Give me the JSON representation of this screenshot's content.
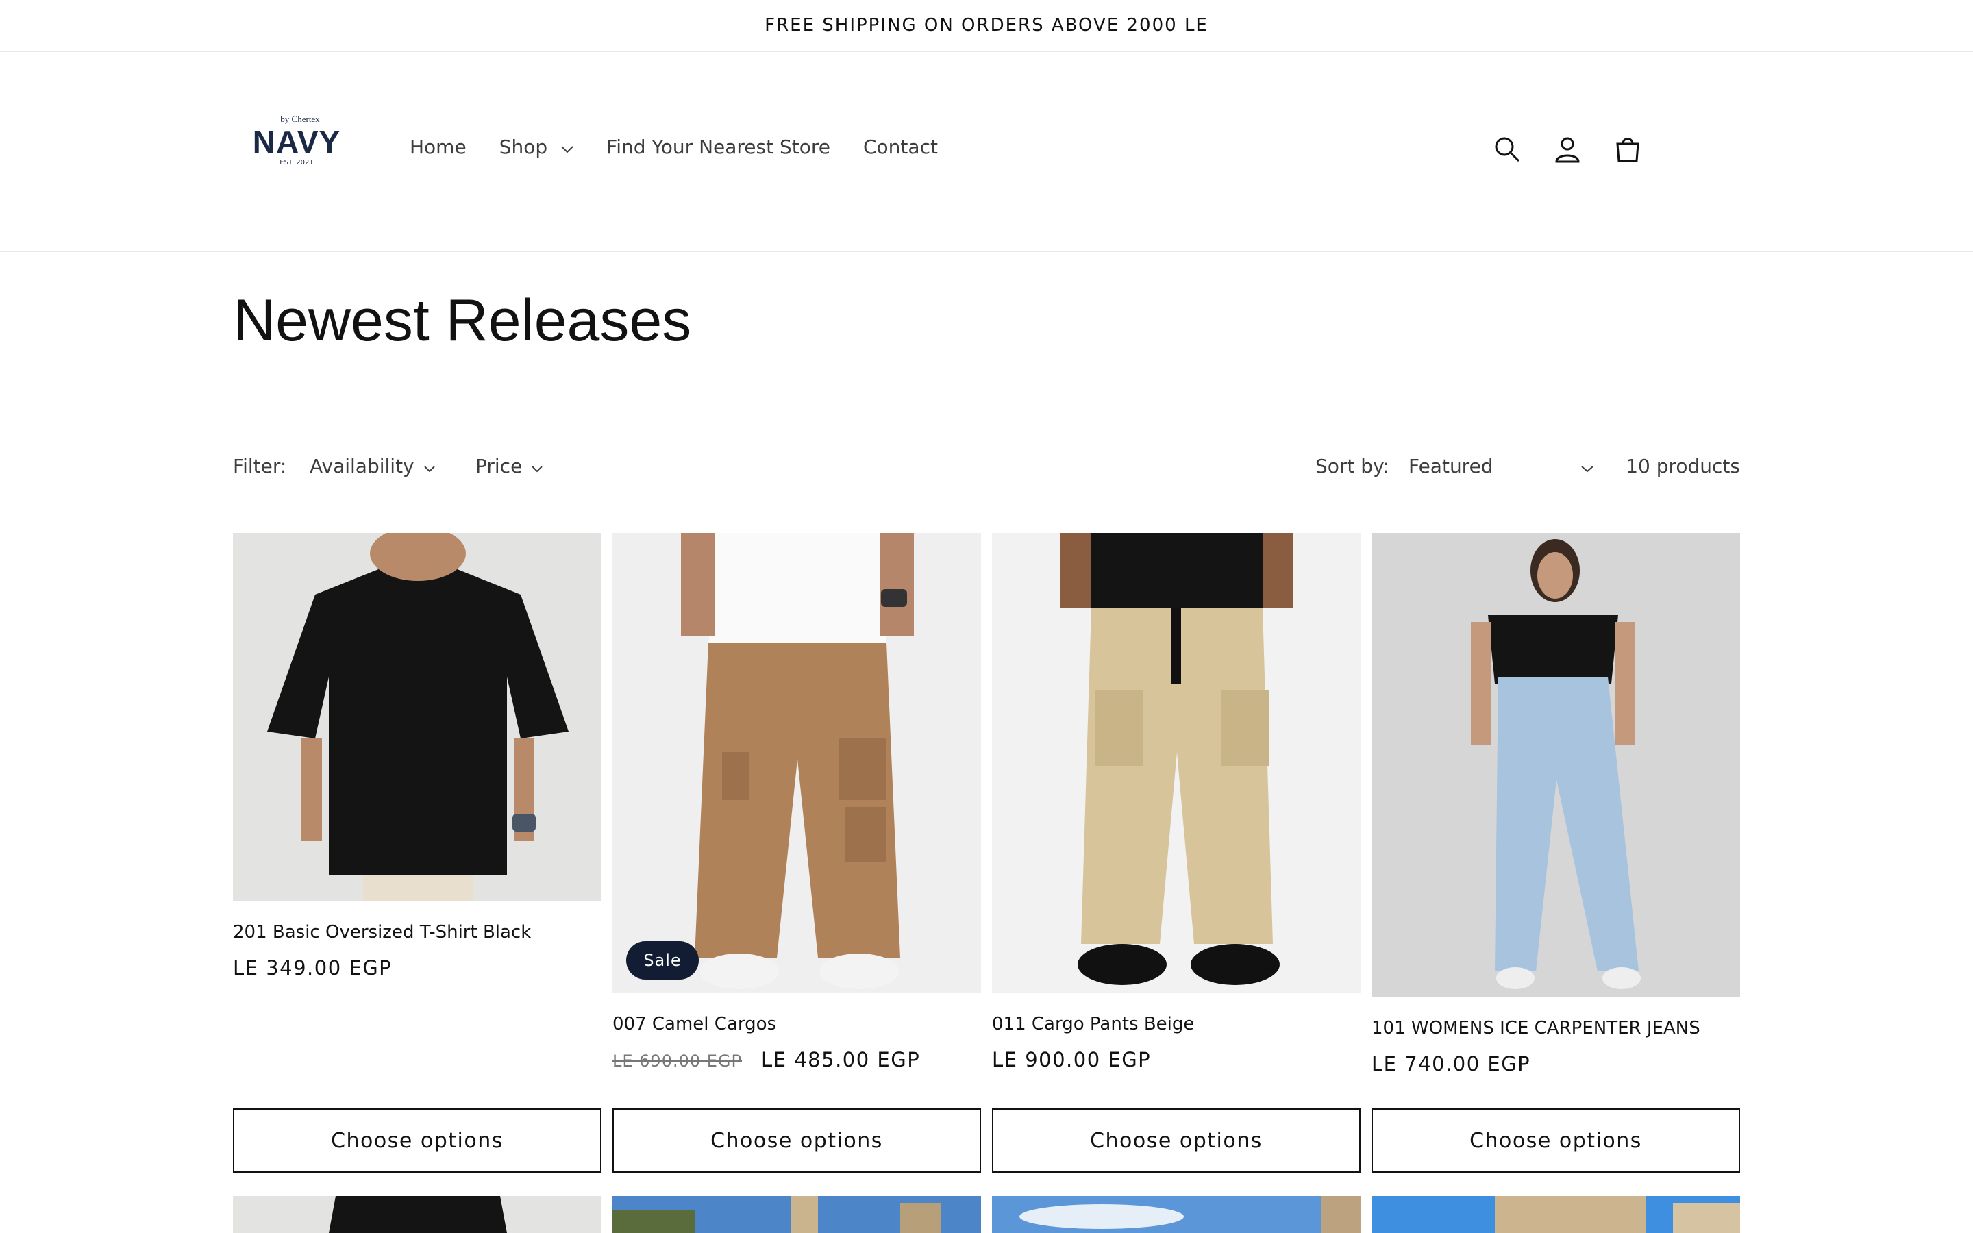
{
  "announcement": "FREE SHIPPING ON ORDERS ABOVE 2000 LE",
  "logo": {
    "by": "by Chertex",
    "name": "NAVY",
    "est": "EST. 2021"
  },
  "nav": {
    "home": "Home",
    "shop": "Shop",
    "store": "Find Your Nearest Store",
    "contact": "Contact"
  },
  "icons": [
    "search-icon",
    "account-icon",
    "cart-icon"
  ],
  "page": {
    "title": "Newest Releases"
  },
  "filters": {
    "label": "Filter:",
    "availability": "Availability",
    "price": "Price",
    "sort_label": "Sort by:",
    "sort_value": "Featured",
    "count": "10 products"
  },
  "products": [
    {
      "name": "201 Basic Oversized T-Shirt Black",
      "price": "LE 349.00 EGP",
      "old_price": "",
      "badge": "",
      "button": "Choose options"
    },
    {
      "name": "007 Camel Cargos",
      "price": "LE 485.00 EGP",
      "old_price": "LE 690.00 EGP",
      "badge": "Sale",
      "button": "Choose options"
    },
    {
      "name": "011 Cargo Pants Beige",
      "price": "LE 900.00 EGP",
      "old_price": "",
      "badge": "",
      "button": "Choose options"
    },
    {
      "name": "101 WOMENS ICE CARPENTER JEANS",
      "price": "LE 740.00 EGP",
      "old_price": "",
      "badge": "",
      "button": "Choose options"
    }
  ],
  "colors": {
    "text": "#121212",
    "badge": "#121c33",
    "border": "#e8e8e8"
  }
}
